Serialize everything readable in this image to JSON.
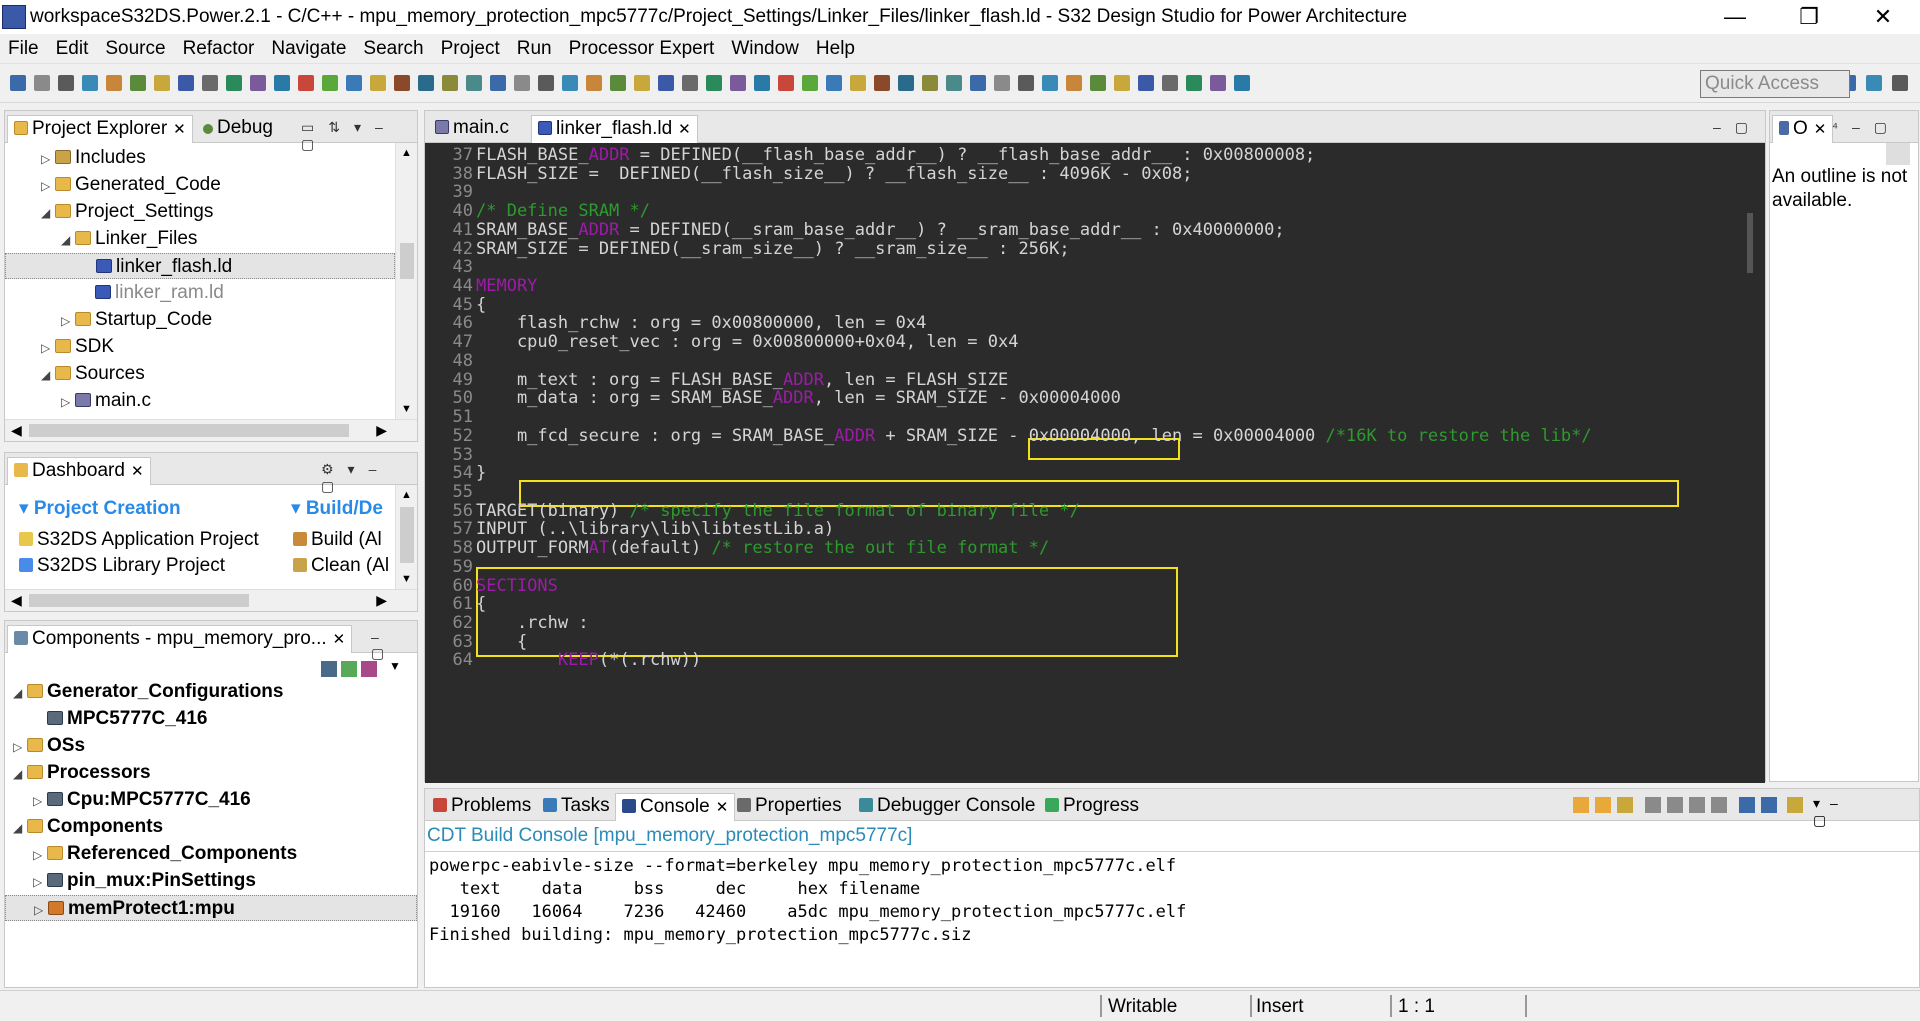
{
  "window": {
    "title": "workspaceS32DS.Power.2.1 - C/C++ - mpu_memory_protection_mpc5777c/Project_Settings/Linker_Files/linker_flash.ld - S32 Design Studio for Power Architecture",
    "minimize": "—",
    "maximize": "❐",
    "close": "✕"
  },
  "menu": [
    "File",
    "Edit",
    "Source",
    "Refactor",
    "Navigate",
    "Search",
    "Project",
    "Run",
    "Processor Expert",
    "Window",
    "Help"
  ],
  "toolbar": {
    "quick_access": "Quick Access"
  },
  "project_explorer": {
    "tabs": [
      {
        "label": "Project Explorer"
      },
      {
        "label": "Debug"
      }
    ],
    "items": [
      {
        "label": "Includes",
        "depth": 1,
        "twisty": "▷",
        "icon": "pkg"
      },
      {
        "label": "Generated_Code",
        "depth": 1,
        "twisty": "▷",
        "icon": "fold"
      },
      {
        "label": "Project_Settings",
        "depth": 1,
        "twisty": "◢",
        "icon": "fold"
      },
      {
        "label": "Linker_Files",
        "depth": 2,
        "twisty": "◢",
        "icon": "fold"
      },
      {
        "label": "linker_flash.ld",
        "depth": 3,
        "twisty": "",
        "icon": "ld",
        "selected": true
      },
      {
        "label": "linker_ram.ld",
        "depth": 3,
        "twisty": "",
        "icon": "ld",
        "dim": true
      },
      {
        "label": "Startup_Code",
        "depth": 2,
        "twisty": "▷",
        "icon": "fold"
      },
      {
        "label": "SDK",
        "depth": 1,
        "twisty": "▷",
        "icon": "fold"
      },
      {
        "label": "Sources",
        "depth": 1,
        "twisty": "◢",
        "icon": "fold"
      },
      {
        "label": "main.c",
        "depth": 2,
        "twisty": "▷",
        "icon": "cfile"
      }
    ]
  },
  "dashboard": {
    "tab": "Dashboard",
    "sections": [
      "Project Creation",
      "Build/De"
    ],
    "left_items": [
      "S32DS Application Project",
      "S32DS Library Project"
    ],
    "right_items": [
      "Build  (Al",
      "Clean  (Al"
    ]
  },
  "components": {
    "tab": "Components - mpu_memory_pro...",
    "items": [
      {
        "label": "Generator_Configurations",
        "depth": 0,
        "twisty": "◢",
        "icon": "fold"
      },
      {
        "label": "MPC5777C_416",
        "depth": 1,
        "twisty": "",
        "icon": "chip"
      },
      {
        "label": "OSs",
        "depth": 0,
        "twisty": "▷",
        "icon": "fold"
      },
      {
        "label": "Processors",
        "depth": 0,
        "twisty": "◢",
        "icon": "fold"
      },
      {
        "label": "Cpu:MPC5777C_416",
        "depth": 1,
        "twisty": "▷",
        "icon": "chip"
      },
      {
        "label": "Components",
        "depth": 0,
        "twisty": "◢",
        "icon": "fold"
      },
      {
        "label": "Referenced_Components",
        "depth": 1,
        "twisty": "▷",
        "icon": "fold"
      },
      {
        "label": "pin_mux:PinSettings",
        "depth": 1,
        "twisty": "▷",
        "icon": "chip"
      },
      {
        "label": "memProtect1:mpu",
        "depth": 1,
        "twisty": "▷",
        "icon": "comp",
        "selected": true
      }
    ]
  },
  "editor": {
    "tabs": [
      {
        "label": "main.c"
      },
      {
        "label": "linker_flash.ld",
        "active": true
      }
    ],
    "lines": [
      {
        "n": "37",
        "segs": [
          [
            "FLASH_BASE_",
            ""
          ],
          [
            "ADDR",
            "kw"
          ],
          [
            " = DEFINED(__flash_base_addr__) ? __flash_base_addr__ : 0x00800008;",
            ""
          ]
        ]
      },
      {
        "n": "38",
        "segs": [
          [
            "FLASH_SIZE =  DEFINED(__flash_size__) ? __flash_size__ : 4096K - 0x08;",
            ""
          ]
        ]
      },
      {
        "n": "39",
        "segs": []
      },
      {
        "n": "40",
        "segs": [
          [
            "/* Define SRAM */",
            "cm"
          ]
        ]
      },
      {
        "n": "41",
        "segs": [
          [
            "SRAM_BASE_",
            ""
          ],
          [
            "ADDR",
            "kw"
          ],
          [
            " = DEFINED(__sram_base_addr__) ? __sram_base_addr__ : 0x40000000;",
            ""
          ]
        ]
      },
      {
        "n": "42",
        "segs": [
          [
            "SRAM_SIZE = DEFINED(__sram_size__) ? __sram_size__ : 256K;",
            ""
          ]
        ]
      },
      {
        "n": "43",
        "segs": []
      },
      {
        "n": "44",
        "segs": [
          [
            "MEMORY",
            "kw"
          ]
        ]
      },
      {
        "n": "45",
        "segs": [
          [
            "{",
            ""
          ]
        ]
      },
      {
        "n": "46",
        "segs": [
          [
            "    flash_rchw : org = 0x00800000, len = 0x4",
            ""
          ]
        ]
      },
      {
        "n": "47",
        "segs": [
          [
            "    cpu0_reset_vec : org = 0x00800000+0x04, len = 0x4",
            ""
          ]
        ]
      },
      {
        "n": "48",
        "segs": []
      },
      {
        "n": "49",
        "segs": [
          [
            "    m_text : org = FLASH_BASE_",
            ""
          ],
          [
            "ADDR",
            "kw"
          ],
          [
            ", len = FLASH_SIZE",
            ""
          ]
        ]
      },
      {
        "n": "50",
        "segs": [
          [
            "    m_data : org = SRAM_BASE_",
            ""
          ],
          [
            "ADDR",
            "kw"
          ],
          [
            ", len = SRAM_SIZE - 0x00004000",
            ""
          ]
        ]
      },
      {
        "n": "51",
        "segs": []
      },
      {
        "n": "52",
        "segs": [
          [
            "    m_fcd_secure : org = SRAM_BASE_",
            ""
          ],
          [
            "ADDR",
            "kw"
          ],
          [
            " + SRAM_SIZE - 0x00004000, len = 0x00004000 ",
            ""
          ],
          [
            "/*16K to restore the lib*/",
            "cm"
          ]
        ]
      },
      {
        "n": "53",
        "segs": []
      },
      {
        "n": "54",
        "segs": [
          [
            "}",
            ""
          ]
        ]
      },
      {
        "n": "55",
        "segs": []
      },
      {
        "n": "56",
        "segs": [
          [
            "TARGET(binary) ",
            ""
          ],
          [
            "/* specify the file format of binary file */",
            "cm"
          ]
        ]
      },
      {
        "n": "57",
        "segs": [
          [
            "INPUT (..\\library\\lib\\libtestLib.a)",
            ""
          ]
        ]
      },
      {
        "n": "58",
        "segs": [
          [
            "OUTPUT_FORM",
            ""
          ],
          [
            "AT",
            "kw"
          ],
          [
            "(default) ",
            ""
          ],
          [
            "/* restore the out file format */",
            "cm"
          ]
        ]
      },
      {
        "n": "59",
        "segs": []
      },
      {
        "n": "60",
        "segs": [
          [
            "SECTIONS",
            "kw"
          ]
        ]
      },
      {
        "n": "61",
        "segs": [
          [
            "{",
            ""
          ]
        ]
      },
      {
        "n": "62",
        "segs": [
          [
            "    .rchw :",
            ""
          ]
        ]
      },
      {
        "n": "63",
        "segs": [
          [
            "    {",
            ""
          ]
        ]
      },
      {
        "n": "64",
        "segs": [
          [
            "        ",
            ""
          ],
          [
            "KEEP",
            "kw"
          ],
          [
            "(*(.rchw))",
            ""
          ]
        ]
      }
    ]
  },
  "outline": {
    "tab": "O",
    "message": "An outline is not available."
  },
  "console": {
    "tabs": [
      "Problems",
      "Tasks",
      "Console",
      "Properties",
      "Debugger Console",
      "Progress"
    ],
    "title": "CDT Build Console [mpu_memory_protection_mpc5777c]",
    "lines": [
      "powerpc-eabivle-size --format=berkeley mpu_memory_protection_mpc5777c.elf",
      "   text    data     bss     dec     hex filename",
      "  19160   16064    7236   42460    a5dc mpu_memory_protection_mpc5777c.elf",
      "Finished building: mpu_memory_protection_mpc5777c.siz"
    ]
  },
  "status": {
    "writable": "Writable",
    "insert": "Insert",
    "position": "1 : 1"
  },
  "colors": {
    "editor_bg": "#2b2b2b",
    "keyword": "#9c1ba8",
    "comment": "#2e9a2e",
    "highlight": "#f3e11a"
  }
}
